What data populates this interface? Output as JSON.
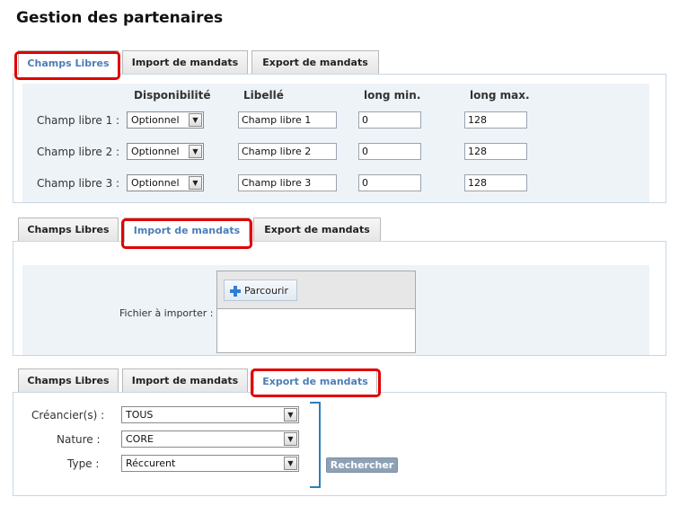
{
  "page_title": "Gestion des partenaires",
  "tabs": {
    "champs_libres": "Champs Libres",
    "import": "Import de mandats",
    "export": "Export de mandats"
  },
  "champs": {
    "headers": {
      "disponibilite": "Disponibilité",
      "libelle": "Libellé",
      "long_min": "long min.",
      "long_max": "long max."
    },
    "rows": [
      {
        "label": "Champ libre 1 :",
        "dispo": "Optionnel",
        "libelle": "Champ libre 1",
        "min": "0",
        "max": "128"
      },
      {
        "label": "Champ libre 2 :",
        "dispo": "Optionnel",
        "libelle": "Champ libre 2",
        "min": "0",
        "max": "128"
      },
      {
        "label": "Champ libre 3 :",
        "dispo": "Optionnel",
        "libelle": "Champ libre 3",
        "min": "0",
        "max": "128"
      }
    ]
  },
  "import": {
    "file_label": "Fichier à importer :",
    "browse_label": "Parcourir"
  },
  "export": {
    "creanciers_label": "Créancier(s) :",
    "creanciers_value": "TOUS",
    "nature_label": "Nature :",
    "nature_value": "CORE",
    "type_label": "Type :",
    "type_value": "Réccurent",
    "search_label": "Rechercher"
  },
  "colors": {
    "active_tab_text": "#4b7db8",
    "highlight": "#e00000",
    "bracket": "#2f7fb8"
  }
}
